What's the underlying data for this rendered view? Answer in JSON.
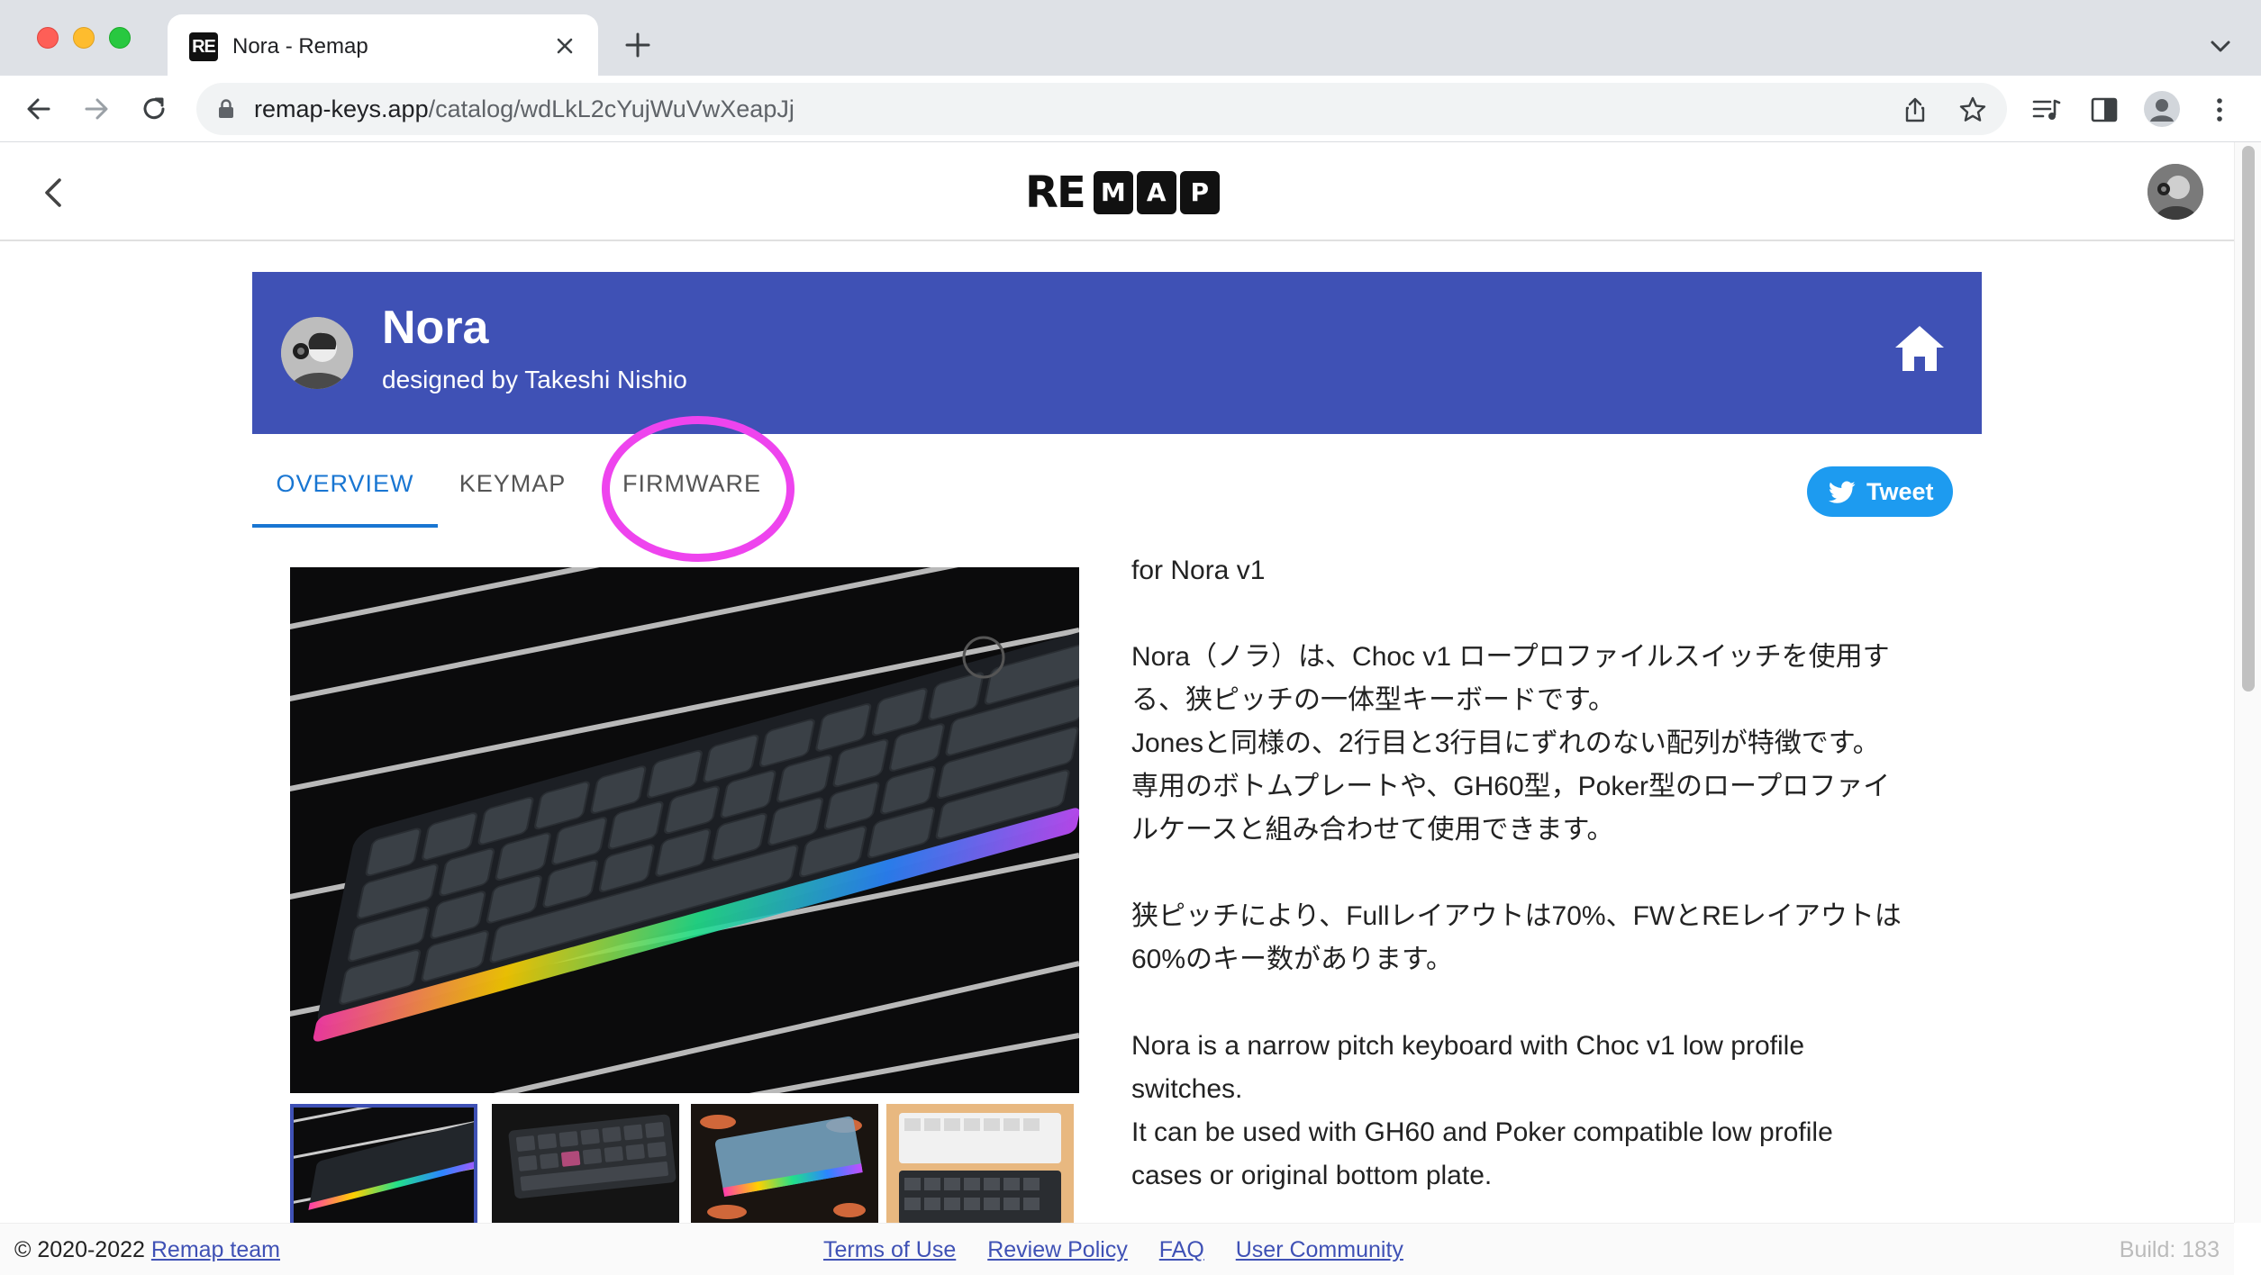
{
  "browser": {
    "tab_title": "Nora - Remap",
    "tab_favicon_text": "RE",
    "url_host": "remap-keys.app",
    "url_path": "/catalog/wdLkL2cYujWuVwXeapJj"
  },
  "app": {
    "logo_prefix": "RE",
    "logo_letters": [
      "M",
      "A",
      "P"
    ]
  },
  "keyboard": {
    "name": "Nora",
    "designer": "designed by Takeshi Nishio"
  },
  "tabs": [
    {
      "label": "OVERVIEW",
      "active": true
    },
    {
      "label": "KEYMAP",
      "active": false
    },
    {
      "label": "FIRMWARE",
      "active": false
    }
  ],
  "tweet_label": "Tweet",
  "description": {
    "p1": "for Nora v1",
    "p2_lines": [
      "Nora（ノラ）は、Choc v1 ロープロファイルスイッチを使用す",
      "る、狭ピッチの一体型キーボードです。",
      "Jonesと同様の、2行目と3行目にずれのない配列が特徴です。",
      "専用のボトムプレートや、GH60型，Poker型のロープロファイ",
      "ルケースと組み合わせて使用できます。"
    ],
    "p3_lines": [
      "狭ピッチにより、Fullレイアウトは70%、FWとREレイアウトは",
      "60%のキー数があります。"
    ],
    "p4_lines": [
      "Nora is a narrow pitch keyboard with Choc v1 low profile",
      "switches.",
      "It can be used with GH60 and Poker compatible low profile",
      "cases or original bottom plate."
    ]
  },
  "footer": {
    "copyright": "© 2020-2022 ",
    "team_link": "Remap team",
    "links": [
      "Terms of Use",
      "Review Policy",
      "FAQ",
      "User Community"
    ],
    "build": "Build: 183"
  },
  "colors": {
    "banner": "#3f51b5",
    "active_tab": "#1976d2",
    "tweet": "#1d9bf0",
    "highlight": "#ee44ee"
  },
  "icons": {
    "back": "chevron-left-icon",
    "home": "home-icon",
    "tweet": "twitter-bird-icon"
  }
}
